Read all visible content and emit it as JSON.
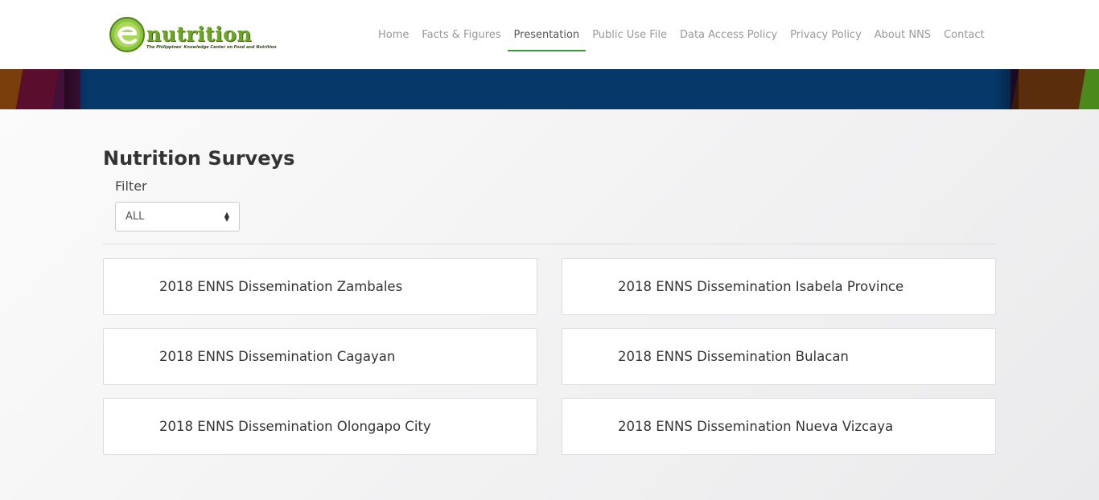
{
  "logo": {
    "text": "nutrition",
    "tagline": "The Philippines' Knowledge Center on Food and Nutrition"
  },
  "nav": {
    "items": [
      {
        "label": "Home"
      },
      {
        "label": "Facts & Figures"
      },
      {
        "label": "Presentation"
      },
      {
        "label": "Public Use File"
      },
      {
        "label": "Data Access Policy"
      },
      {
        "label": "Privacy Policy"
      },
      {
        "label": "About NNS"
      },
      {
        "label": "Contact"
      }
    ],
    "active": "Presentation"
  },
  "page": {
    "title": "Nutrition Surveys",
    "filter_label": "Filter",
    "filter_value": "ALL"
  },
  "cards": [
    {
      "title": "2018 ENNS Dissemination Zambales"
    },
    {
      "title": "2018 ENNS Dissemination Isabela Province"
    },
    {
      "title": "2018 ENNS Dissemination Cagayan"
    },
    {
      "title": "2018 ENNS Dissemination Bulacan"
    },
    {
      "title": "2018 ENNS Dissemination Olongapo City"
    },
    {
      "title": "2018 ENNS Dissemination Nueva Vizcaya"
    }
  ],
  "colors": {
    "accent_green": "#3a9a3a",
    "banner_blue": "#06386a"
  }
}
